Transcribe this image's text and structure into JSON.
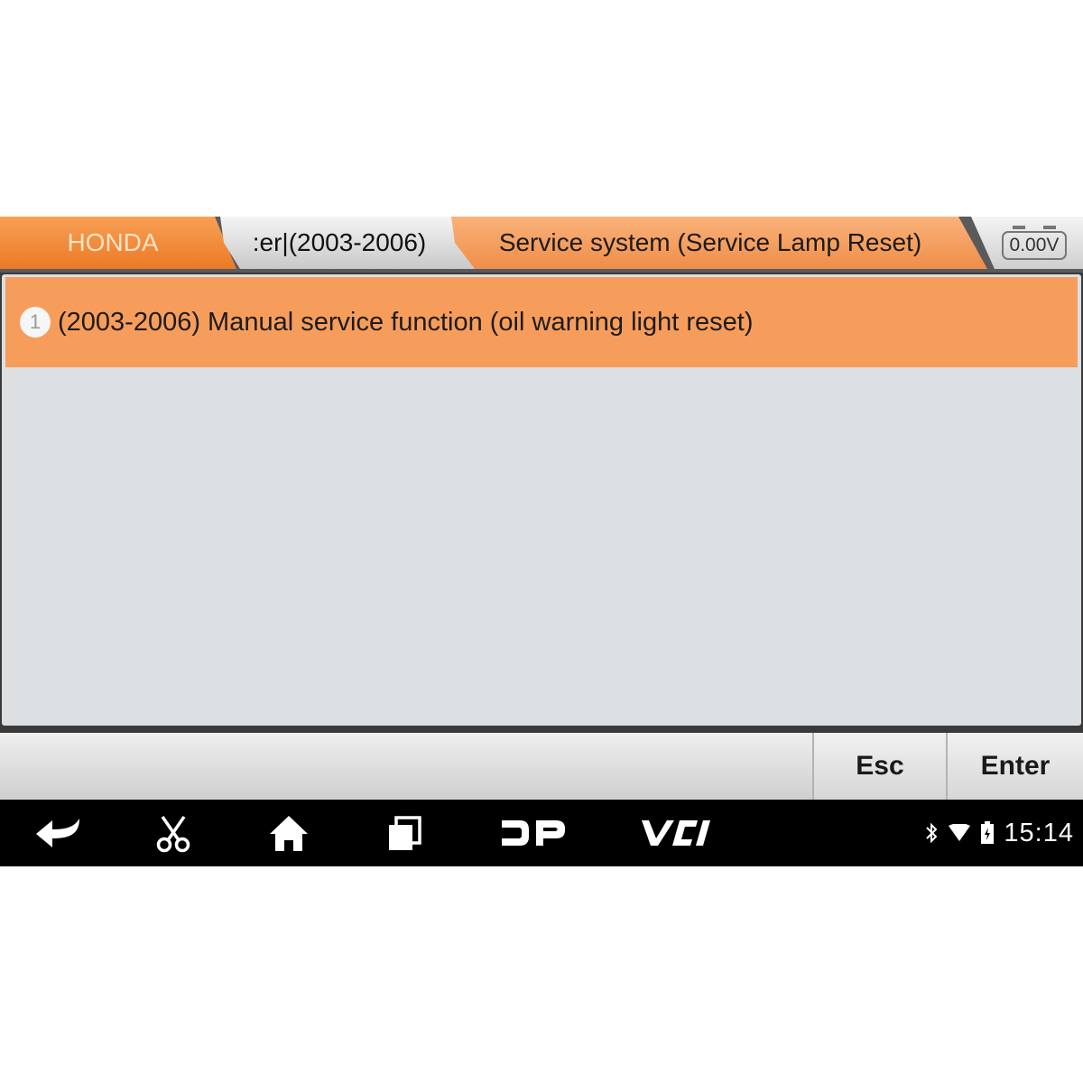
{
  "breadcrumb": {
    "brand": "HONDA",
    "model": ":er|(2003-2006)",
    "current": "Service system (Service Lamp Reset)"
  },
  "battery_voltage": "0.00V",
  "menu": {
    "items": [
      {
        "number": "1",
        "label": "(2003-2006) Manual service function (oil warning light reset)"
      }
    ]
  },
  "buttons": {
    "esc": "Esc",
    "enter": "Enter"
  },
  "navbar": {
    "icons": [
      "back-icon",
      "screenshot-scissors-icon",
      "home-icon",
      "recent-apps-icon",
      "dp-logo-icon",
      "vci-icon"
    ],
    "dp_label": "DP",
    "vci_label": "VCI"
  },
  "status_bar": {
    "icons": [
      "bluetooth-icon",
      "wifi-icon",
      "battery-icon"
    ],
    "time": "15:14"
  },
  "colors": {
    "accent_orange": "#f79d5c",
    "tab_orange": "#ec7a26",
    "panel_gray": "#dcdfe1",
    "navbar_black": "#000000"
  }
}
